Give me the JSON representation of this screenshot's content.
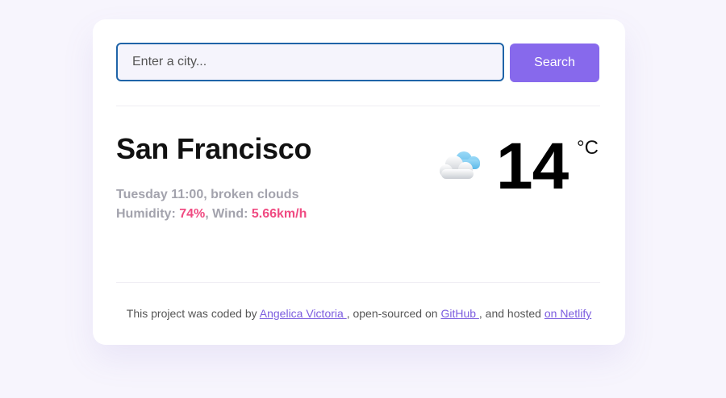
{
  "search": {
    "placeholder": "Enter a city...",
    "value": "",
    "button_label": "Search"
  },
  "weather": {
    "city": "San Francisco",
    "day_time": "Tuesday 11:00",
    "description": "broken clouds",
    "humidity_label": "Humidity: ",
    "humidity": "74%",
    "wind_label": "Wind: ",
    "wind": "5.66km/h",
    "temperature": "14",
    "unit": "°C",
    "icon": "cloud-icon"
  },
  "footer": {
    "prefix": "This project was coded by ",
    "author": "Angelica Victoria ",
    "middle": ", open-sourced on ",
    "github": "GitHub ",
    "middle2": ", and hosted ",
    "netlify": "on Netlify"
  },
  "colors": {
    "accent": "#8769ec",
    "highlight": "#f04b82",
    "input_border": "#1f64a8"
  }
}
